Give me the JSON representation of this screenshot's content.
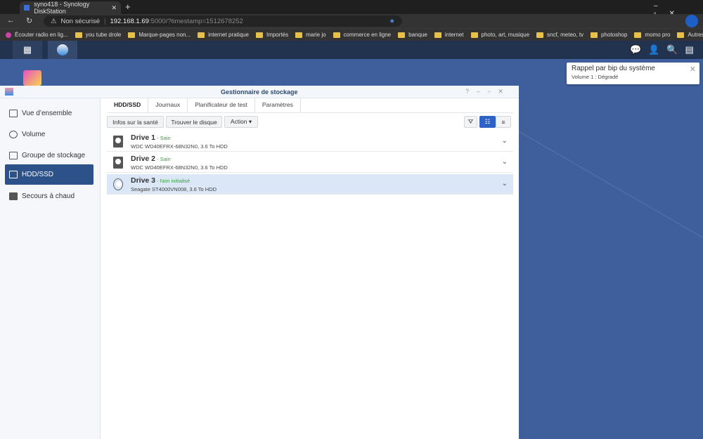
{
  "browser": {
    "tab_title": "syno418 - Synology DiskStation",
    "security": "Non sécurisé",
    "url_host": "192.168.1.69",
    "url_rest": ":5000/?timestamp=1512678252",
    "bookmarks": [
      "Écouter radio en lig...",
      "you tube drole",
      "Marque-pages non...",
      "internet pratique",
      "Importés",
      "marie jo",
      "commerce en ligne",
      "banque",
      "internet",
      "photo, art, musique",
      "sncf, meteo, tv",
      "photoshop",
      "momo pro"
    ],
    "other_favorites": "Autres favoris"
  },
  "notification": {
    "title": "Rappel par bip du système",
    "message": "Volume 1 : Dégradé"
  },
  "window": {
    "title": "Gestionnaire de stockage"
  },
  "sidebar": {
    "items": [
      {
        "label": "Vue d’ensemble"
      },
      {
        "label": "Volume"
      },
      {
        "label": "Groupe de stockage"
      },
      {
        "label": "HDD/SSD"
      },
      {
        "label": "Secours à chaud"
      }
    ]
  },
  "tabs": [
    "HDD/SSD",
    "Journaux",
    "Planificateur de test",
    "Paramètres"
  ],
  "toolbar": {
    "health": "Infos sur la santé",
    "find": "Trouver le disque",
    "action": "Action ▾"
  },
  "drives": [
    {
      "name": "Drive 1",
      "status": " - Sain",
      "model": "WDC WD40EFRX-68N32N0, 3.6 To HDD"
    },
    {
      "name": "Drive 2",
      "status": " - Sain",
      "model": "WDC WD40EFRX-68N32N0, 3.6 To HDD"
    },
    {
      "name": "Drive 3",
      "status": " - Non initialisé",
      "model": "Seagate ST4000VN008, 3.6 To HDD"
    }
  ]
}
